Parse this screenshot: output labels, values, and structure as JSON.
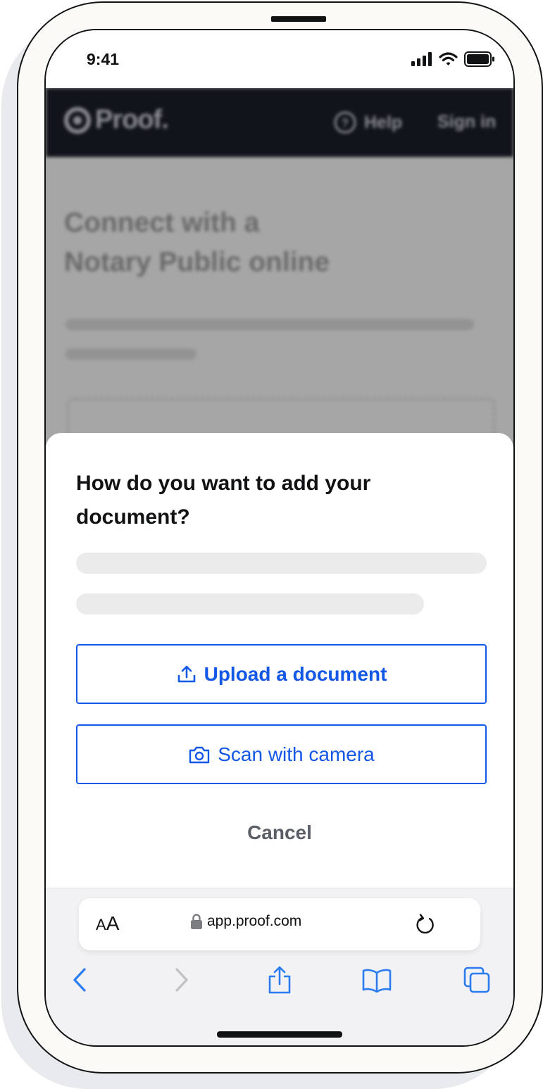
{
  "status_bar": {
    "time": "9:41"
  },
  "website": {
    "logo_text": "Proof.",
    "help_label": "Help",
    "sign_in_label": "Sign in",
    "hero_title_line1": "Connect with a",
    "hero_title_line2": "Notary Public online"
  },
  "sheet": {
    "title": "How do you want to add your document?",
    "upload_button_label": "Upload a document",
    "scan_button_label": "Scan with camera",
    "cancel_label": "Cancel"
  },
  "browser": {
    "text_size_label_small": "A",
    "text_size_label_big": "A",
    "url": "app.proof.com"
  },
  "colors": {
    "accent": "#1257e6",
    "site_header": "#12141c",
    "overlay": "#a6a6a6"
  },
  "icons": [
    "signal-icon",
    "wifi-icon",
    "battery-icon",
    "upload-icon",
    "camera-icon",
    "lock-icon",
    "reload-icon",
    "back-icon",
    "forward-icon",
    "share-icon",
    "bookmarks-icon",
    "tabs-icon"
  ]
}
